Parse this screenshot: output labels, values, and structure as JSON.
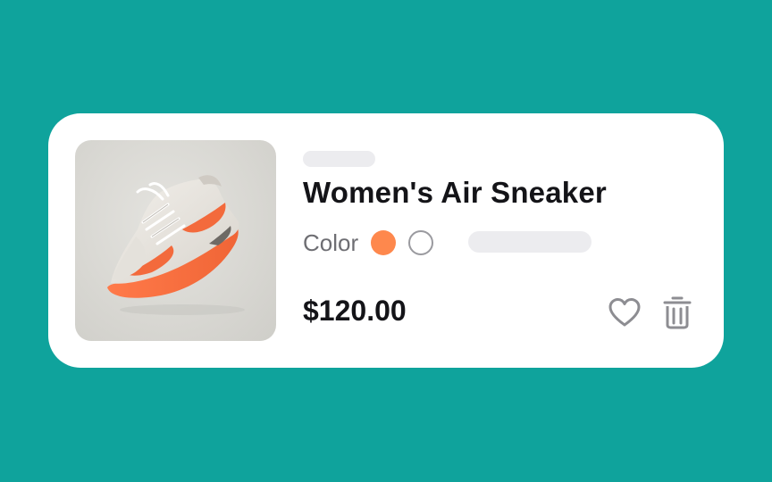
{
  "product": {
    "title": "Women's Air Sneaker",
    "color_label": "Color",
    "price": "$120.00",
    "colors": {
      "orange": "#fe884d",
      "white": "#ffffff"
    },
    "image_icon": "sneaker-photo"
  },
  "actions": {
    "favorite_icon": "heart-icon",
    "delete_icon": "trash-icon"
  },
  "theme": {
    "background": "#0fa39c",
    "card": "#ffffff",
    "skeleton": "#ececef"
  }
}
